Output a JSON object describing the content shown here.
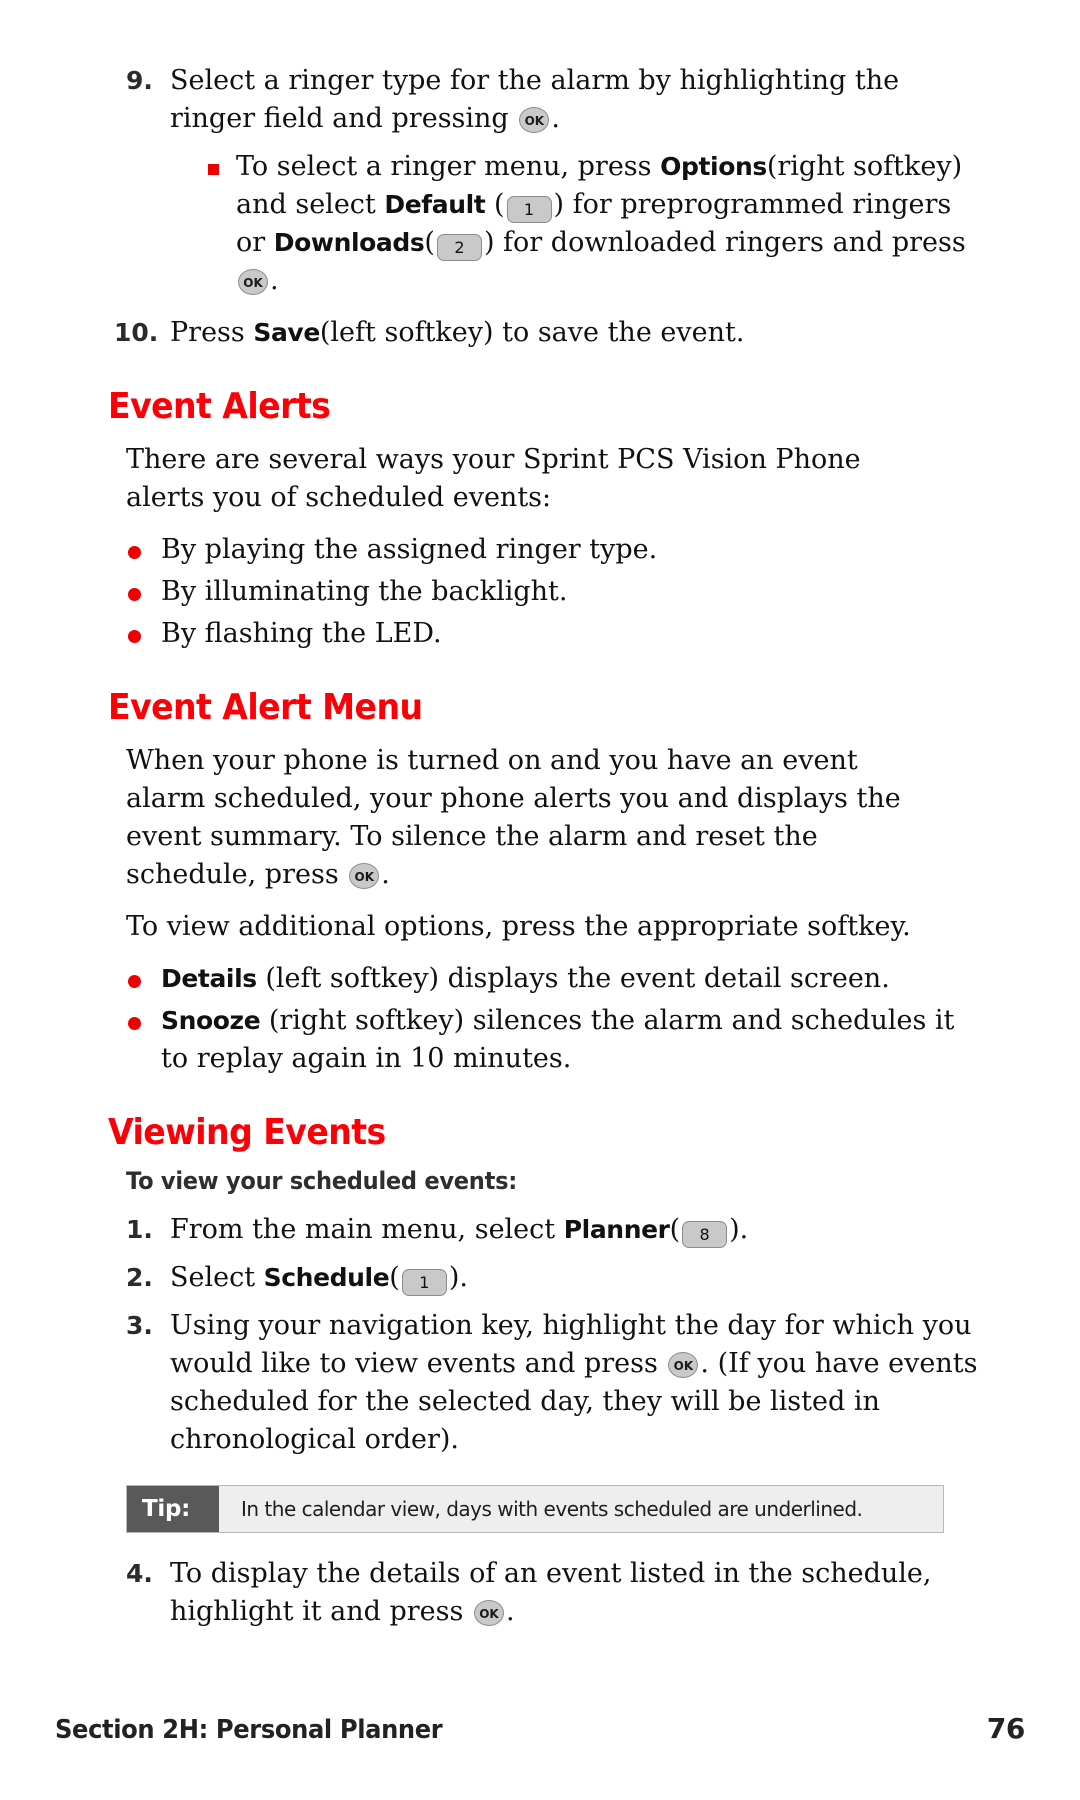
{
  "page": {
    "number": "76",
    "footer_section": "Section 2H: Personal Planner"
  },
  "steps_top": [
    {
      "num": "9.",
      "text_a": "Select a ringer type for the alarm by highlighting the ringer field and pressing",
      "key": "OK",
      "text_b": "."
    },
    {
      "num": "10.",
      "text_a": "Press",
      "bold": "Save",
      "text_b": "(left softkey) to save the event."
    }
  ],
  "substep": {
    "part1": "To select a ringer menu, press",
    "bold1": "Options",
    "part2": "(right softkey) and select",
    "bold2": "Default",
    "key1": "1",
    "part3": ") for preprogrammed ringers or",
    "bold3": "Downloads",
    "key2": "2",
    "part4": ") for downloaded ringers and press",
    "key3": "OK",
    "part5": "."
  },
  "sections": {
    "event_alerts": {
      "heading": "Event Alerts",
      "intro": "There are several ways your Sprint PCS Vision Phone alerts you of scheduled events:",
      "bullets": [
        "By playing the assigned ringer type.",
        "By illuminating the backlight.",
        "By flashing the LED."
      ]
    },
    "event_alert_menu": {
      "heading": "Event Alert Menu",
      "para1_a": "When your phone is turned on and you have an event alarm scheduled, your phone alerts you and displays the event summary. To silence the alarm and reset the schedule, press",
      "para1_key": "OK",
      "para1_b": ".",
      "para2": "To view additional options, press the appropriate softkey.",
      "bullets": [
        {
          "bold": "Details",
          "rest": "(left softkey) displays the event detail screen."
        },
        {
          "bold": "Snooze",
          "rest": "(right softkey) silences the alarm and schedules it to replay again in 10 minutes."
        }
      ]
    },
    "viewing_events": {
      "heading": "Viewing Events",
      "subhead": "To view your scheduled events:",
      "steps": [
        {
          "num": "1.",
          "text_a": "From the main menu, select",
          "bold": "Planner",
          "key": "8",
          "text_b": ")."
        },
        {
          "num": "2.",
          "text_a": "Select",
          "bold": "Schedule",
          "key": "1",
          "text_b": ")."
        },
        {
          "num": "3.",
          "text_a": "Using your navigation key, highlight the day for which you would like to view events and press",
          "key": "OK",
          "text_b": ". (If you have events scheduled for the selected day, they will be listed in chronological order)."
        },
        {
          "num": "4.",
          "text_a": "To display the details of an event listed in the schedule, highlight it and press",
          "key": "OK",
          "text_b": "."
        }
      ],
      "tip": {
        "label": "Tip:",
        "text": "In the calendar view, days with events scheduled are underlined."
      }
    }
  }
}
